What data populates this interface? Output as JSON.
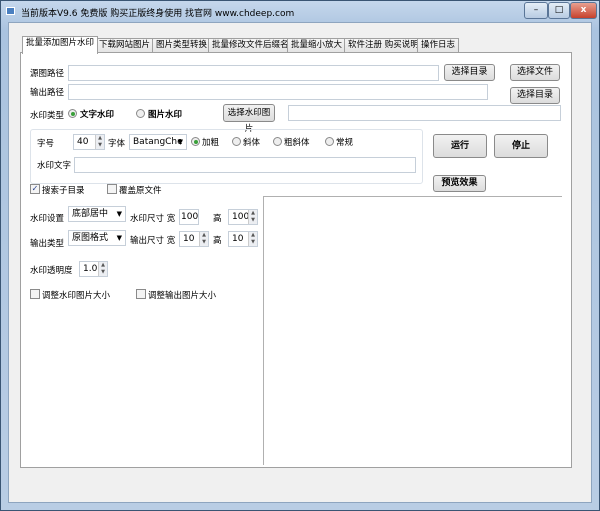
{
  "window": {
    "title": "当前版本V9.6 免费版 购买正版终身使用 找官网 www.chdeep.com",
    "minimize": "–",
    "maximize": "□",
    "close": "x"
  },
  "tabs": [
    {
      "label": "批量添加图片水印",
      "active": true
    },
    {
      "label": "下载网站图片"
    },
    {
      "label": "图片类型转换"
    },
    {
      "label": "批量修改文件后缀名"
    },
    {
      "label": "批量缩小放大"
    },
    {
      "label": "软件注册 购买说明"
    },
    {
      "label": "操作日志"
    }
  ],
  "source": {
    "label": "源图路径",
    "value": "",
    "select_dir": "选择目录",
    "select_file": "选择文件"
  },
  "output": {
    "label": "输出路径",
    "value": "",
    "select_dir": "选择目录"
  },
  "watermark_type": {
    "label": "水印类型",
    "text_option": "文字水印",
    "image_option": "图片水印",
    "selected": "文字水印",
    "select_image": "选择水印图片",
    "image_path": ""
  },
  "font": {
    "size_label": "字号",
    "size": "40",
    "font_label": "字体",
    "font": "BatangChe",
    "styles": [
      "加粗",
      "斜体",
      "粗斜体",
      "常规"
    ],
    "selected_style": "加粗"
  },
  "watermark_text": {
    "label": "水印文字",
    "value": ""
  },
  "actions": {
    "run": "运行",
    "stop": "停止",
    "preview": "预览效果"
  },
  "options": {
    "search_subdirs": {
      "label": "搜索子目录",
      "checked": true
    },
    "overwrite": {
      "label": "覆盖原文件",
      "checked": false
    }
  },
  "watermark_settings": {
    "label": "水印设置",
    "position": "底部居中",
    "size_label": "水印尺寸 宽",
    "width": "100",
    "height_label": "高",
    "height": "100"
  },
  "output_type": {
    "label": "输出类型",
    "format": "原图格式",
    "size_label": "输出尺寸 宽",
    "width": "10",
    "height_label": "高",
    "height": "10"
  },
  "opacity": {
    "label": "水印透明度",
    "value": "1.0"
  },
  "resize": {
    "watermark": {
      "label": "调整水印图片大小",
      "checked": false
    },
    "output": {
      "label": "调整输出图片大小",
      "checked": false
    }
  }
}
